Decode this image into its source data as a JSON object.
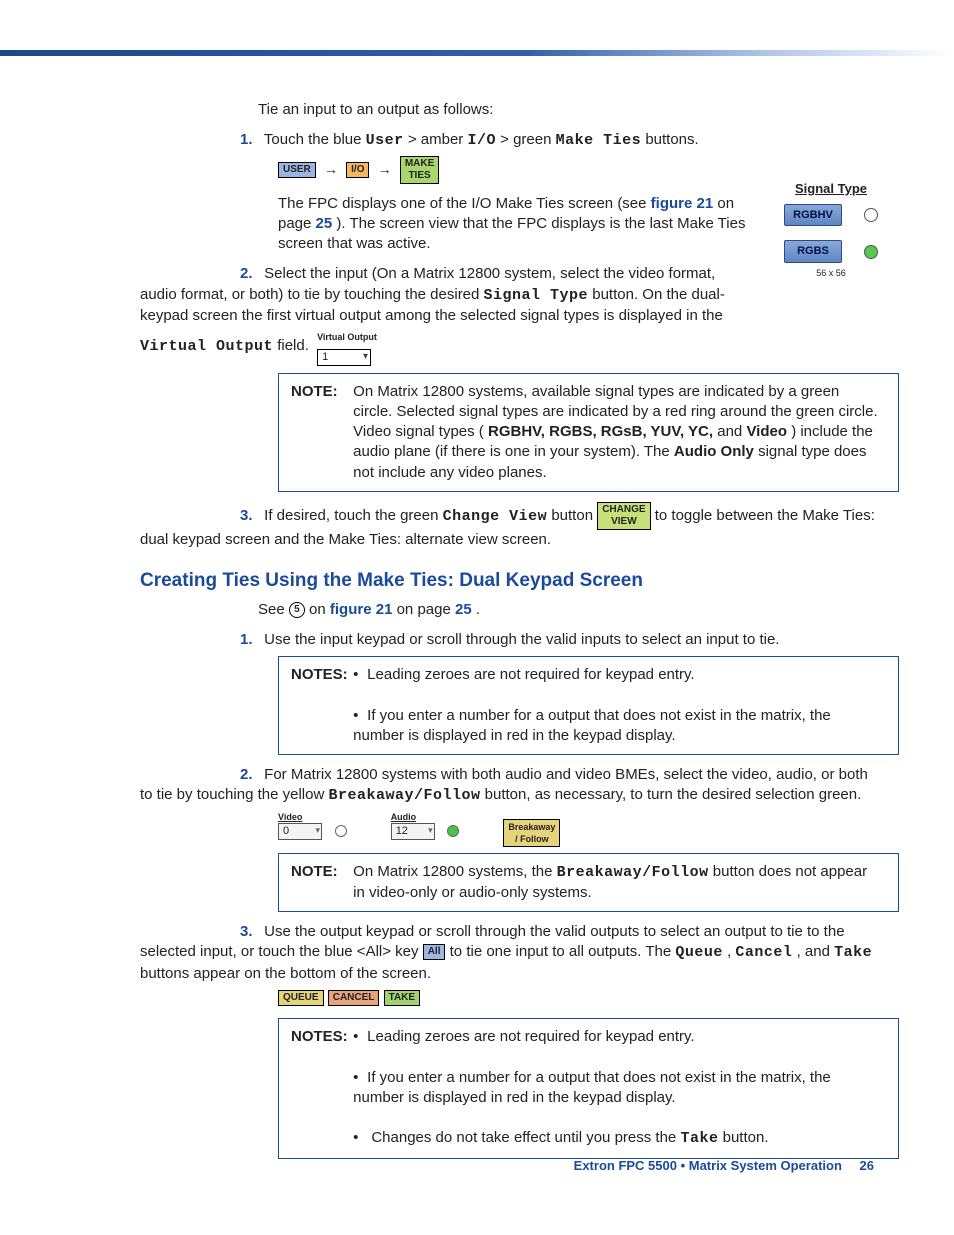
{
  "intro": "Tie an input to an output as follows:",
  "steps": [
    {
      "n": "1.",
      "txt": [
        "Touch the blue ",
        " > amber ",
        " > green ",
        " buttons."
      ],
      "kw": [
        "User",
        "I/O",
        "Make Ties"
      ],
      "mini_btns": {
        "user": "USER",
        "io": "I/O",
        "make": "MAKE\nTIES"
      },
      "after": [
        "The FPC displays one of the I/O Make Ties screen (see ",
        "figure 21",
        " on page ",
        "25",
        "). The screen view that the FPC displays is the last Make Ties screen that was active."
      ]
    },
    {
      "n": "2.",
      "body": [
        "Select the input (On a Matrix 12800 system, select the video format, audio format, or both) to tie by touching the desired ",
        "Signal Type",
        " button. On the dual-keypad screen the first virtual output among the selected signal types is displayed in the ",
        "Virtual Output",
        " field."
      ],
      "vout_label": "Virtual Output",
      "vout_value": "1"
    },
    {
      "n": "3.",
      "body": [
        "If desired, touch the green ",
        "Change View",
        " button ",
        " to toggle between the Make Ties: dual keypad screen and the Make Ties: alternate view screen."
      ],
      "cv_btn": "CHANGE\nVIEW"
    }
  ],
  "note_a": {
    "label": "NOTE:",
    "p1": [
      "On Matrix 12800 systems, available signal types are indicated by a green circle. Selected signal types are indicated by a red ring around the green circle."
    ],
    "p2": [
      "Video signal types (",
      "RGBHV, RGBS, RGsB, YUV, YC,",
      " and ",
      "Video",
      ") include the audio plane (if there is one in your system). The ",
      "Audio Only",
      " signal type does not include any video planes."
    ]
  },
  "sig": {
    "title": "Signal Type",
    "b1": "RGBHV",
    "b2": "RGBS",
    "foot": "56 x 56"
  },
  "h2": "Creating Ties Using the Make Ties: Dual Keypad Screen",
  "see": [
    "See ",
    "5",
    " on ",
    "figure 21",
    " on page ",
    "25",
    "."
  ],
  "dsteps": [
    {
      "n": "1.",
      "txt": "Use the input keypad or scroll through the valid inputs to select an input to tie."
    },
    {
      "n": "2.",
      "pre": "For Matrix 12800 systems with both audio and video BMEs, select the video, audio, or both to tie by touching the yellow ",
      "kw": "Breakaway/Follow",
      "post": " button, as necessary, to turn the desired selection green."
    },
    {
      "n": "3.",
      "segs": [
        "Use the output keypad or scroll through the valid outputs to select an output to tie to the selected input, or touch the blue <All> key ",
        " to tie one input to all outputs. The ",
        "Queue",
        ", ",
        "Cancel",
        ", and ",
        "Take",
        " buttons appear on the bottom of the screen."
      ]
    }
  ],
  "notes_b": {
    "label": "NOTES:",
    "items": [
      "Leading zeroes are not required for keypad entry.",
      "If you enter a number for a output that does not exist in the matrix, the number is displayed in red in the keypad display."
    ]
  },
  "note_c": {
    "label": "NOTE:",
    "txt": [
      "On Matrix 12800 systems, the ",
      "Breakaway/Follow",
      " button does not appear in video-only or audio-only systems."
    ]
  },
  "notes_d": {
    "label": "NOTES:",
    "items": [
      "Leading zeroes are not required for keypad entry.",
      "If you enter a number for a output that does not exist in the matrix, the number is displayed in red in the keypad display.",
      [
        "Changes do not take effect until you press the ",
        "Take",
        " button."
      ]
    ]
  },
  "av": {
    "video": "Video",
    "audio": "Audio",
    "v": "0",
    "a": "12",
    "bf": "Breakaway\n/ Follow"
  },
  "btns3": {
    "all": "All",
    "queue": "QUEUE",
    "cancel": "CANCEL",
    "take": "TAKE"
  },
  "footer": {
    "txt": "Extron FPC 5500 • Matrix System Operation",
    "pg": "26"
  }
}
